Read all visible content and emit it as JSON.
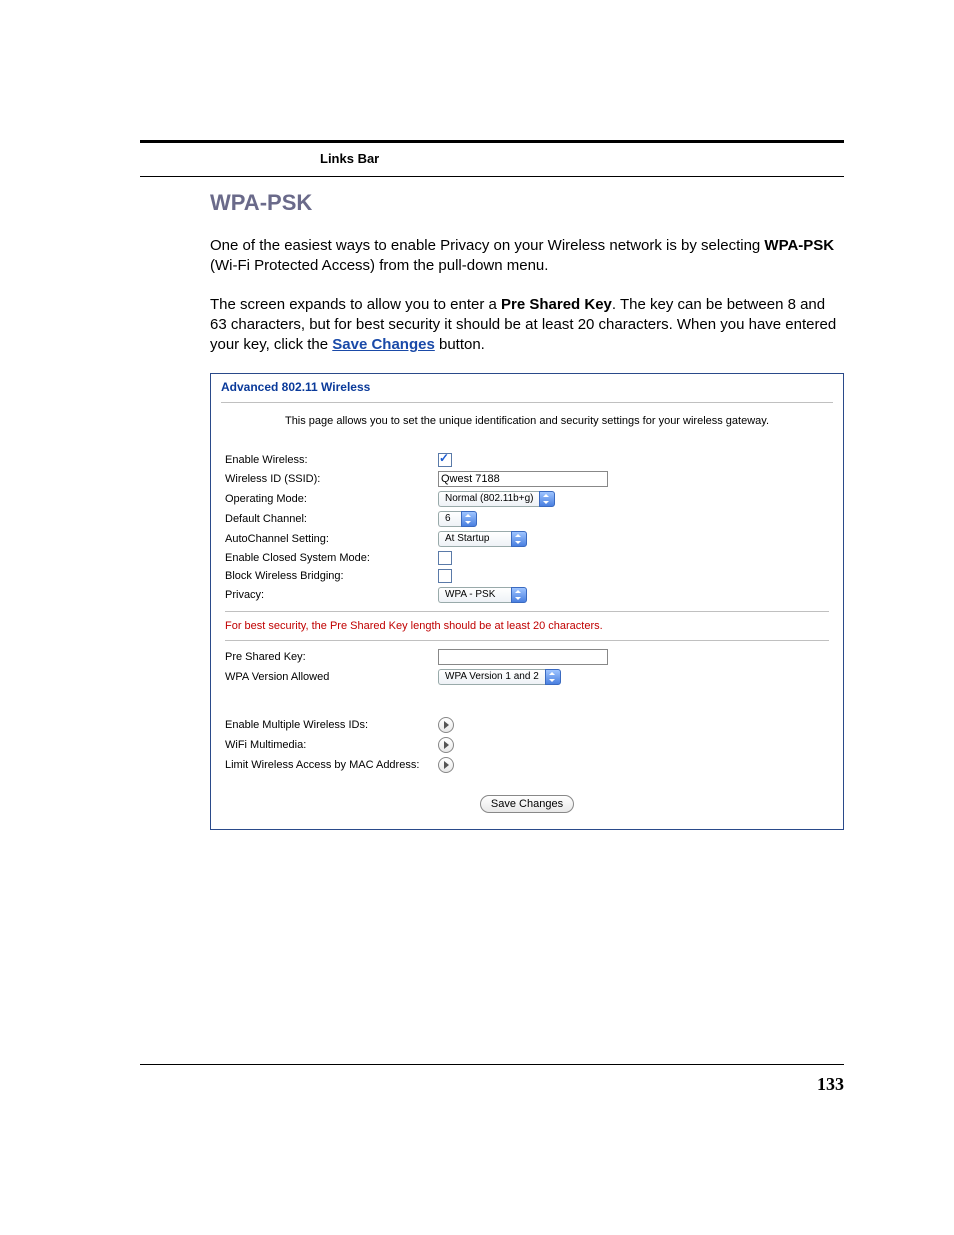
{
  "header": {
    "links_bar": "Links Bar"
  },
  "section": {
    "title": "WPA-PSK",
    "p1_a": "One of the easiest ways to enable Privacy on your Wireless network is by selecting ",
    "p1_b": "WPA-PSK",
    "p1_c": " (Wi-Fi Protected Access) from the pull-down menu.",
    "p2_a": "The screen expands to allow you to enter a ",
    "p2_b": "Pre Shared Key",
    "p2_c": ". The key can be between 8 and 63 characters, but for best security it should be at least 20 characters. When you have entered your key, click the ",
    "p2_link": "Save Changes",
    "p2_d": " button."
  },
  "ui": {
    "title": "Advanced 802.11 Wireless",
    "intro": "This page allows you to set the unique identification and security settings for your wireless gateway.",
    "labels": {
      "enable_wireless": "Enable Wireless:",
      "ssid": "Wireless ID (SSID):",
      "operating_mode": "Operating Mode:",
      "default_channel": "Default Channel:",
      "autochannel": "AutoChannel Setting:",
      "closed_system": "Enable Closed System Mode:",
      "block_bridging": "Block Wireless Bridging:",
      "privacy": "Privacy:",
      "psk": "Pre Shared Key:",
      "wpa_version": "WPA Version Allowed",
      "multi_ids": "Enable Multiple Wireless IDs:",
      "wmm": "WiFi Multimedia:",
      "mac_limit": "Limit Wireless Access by MAC Address:"
    },
    "values": {
      "ssid": "Qwest 7188",
      "operating_mode": "Normal (802.11b+g)",
      "default_channel": "6",
      "autochannel": "At Startup",
      "privacy": "WPA - PSK",
      "psk": "",
      "wpa_version": "WPA Version 1 and 2"
    },
    "warning": "For best security, the Pre Shared Key length should be at least 20 characters.",
    "save_button": "Save Changes"
  },
  "page_number": "133"
}
